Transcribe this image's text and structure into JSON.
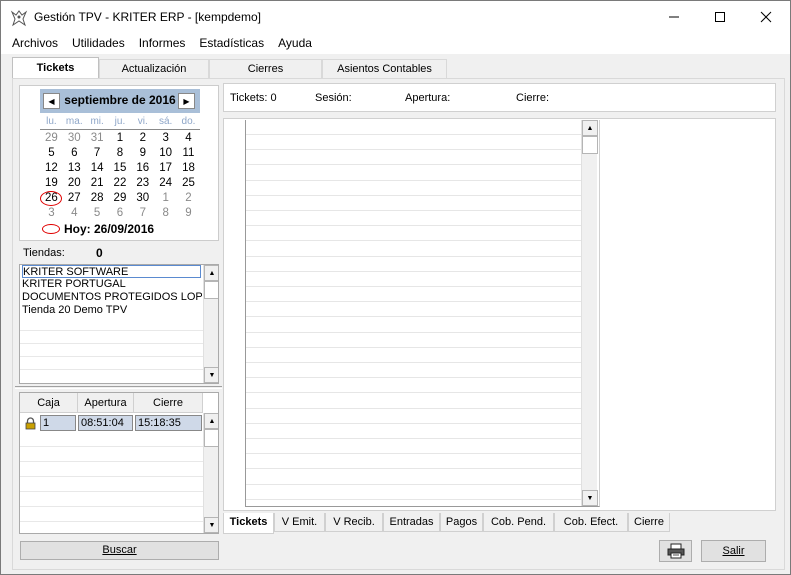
{
  "window": {
    "title": "Gestión TPV - KRITER ERP - [kempdemo]",
    "minimize": "—",
    "maximize": "☐",
    "close": "✕"
  },
  "menu": [
    "Archivos",
    "Utilidades",
    "Informes",
    "Estadísticas",
    "Ayuda"
  ],
  "main_tabs": [
    "Tickets",
    "Actualización",
    "Cierres",
    "Asientos Contables"
  ],
  "calendar": {
    "month": "septiembre de 2016",
    "weekdays": [
      "lu.",
      "ma.",
      "mi.",
      "ju.",
      "vi.",
      "sá.",
      "do."
    ],
    "weeks": [
      [
        {
          "d": "29",
          "m": true
        },
        {
          "d": "30",
          "m": true
        },
        {
          "d": "31",
          "m": true
        },
        {
          "d": "1"
        },
        {
          "d": "2"
        },
        {
          "d": "3"
        },
        {
          "d": "4"
        }
      ],
      [
        {
          "d": "5"
        },
        {
          "d": "6"
        },
        {
          "d": "7"
        },
        {
          "d": "8"
        },
        {
          "d": "9"
        },
        {
          "d": "10"
        },
        {
          "d": "11"
        }
      ],
      [
        {
          "d": "12"
        },
        {
          "d": "13"
        },
        {
          "d": "14"
        },
        {
          "d": "15"
        },
        {
          "d": "16"
        },
        {
          "d": "17"
        },
        {
          "d": "18"
        }
      ],
      [
        {
          "d": "19"
        },
        {
          "d": "20"
        },
        {
          "d": "21"
        },
        {
          "d": "22"
        },
        {
          "d": "23",
          "sel": true
        },
        {
          "d": "24"
        },
        {
          "d": "25"
        }
      ],
      [
        {
          "d": "26",
          "today": true
        },
        {
          "d": "27"
        },
        {
          "d": "28"
        },
        {
          "d": "29"
        },
        {
          "d": "30"
        },
        {
          "d": "1",
          "m": true
        },
        {
          "d": "2",
          "m": true
        }
      ],
      [
        {
          "d": "3",
          "m": true
        },
        {
          "d": "4",
          "m": true
        },
        {
          "d": "5",
          "m": true
        },
        {
          "d": "6",
          "m": true
        },
        {
          "d": "7",
          "m": true
        },
        {
          "d": "8",
          "m": true
        },
        {
          "d": "9",
          "m": true
        }
      ]
    ],
    "today_label": "Hoy: 26/09/2016",
    "prev": "◀",
    "next": "▶"
  },
  "tiendas": {
    "label": "Tiendas:",
    "count": "0",
    "items": [
      "KRITER SOFTWARE",
      "KRITER PORTUGAL",
      "DOCUMENTOS PROTEGIDOS LOPD",
      "Tienda 20 Demo TPV"
    ]
  },
  "caja_grid": {
    "headers": [
      "Caja",
      "Apertura",
      "Cierre"
    ],
    "rows": [
      {
        "caja": "1",
        "apertura": "08:51:04",
        "cierre": "15:18:35"
      }
    ]
  },
  "buscar_label": "Buscar",
  "info_bar": {
    "tickets": "Tickets: 0",
    "sesion": "Sesión:",
    "apertura": "Apertura:",
    "cierre": "Cierre:"
  },
  "bottom_tabs": [
    "Tickets",
    "V Emit.",
    "V Recib.",
    "Entradas",
    "Pagos",
    "Cob. Pend.",
    "Cob. Efect.",
    "Cierre"
  ],
  "salir_label": "Salir",
  "icons": {
    "printer": "printer-icon",
    "lock": "lock-icon",
    "app": "app-logo-icon"
  },
  "colors": {
    "calendar_header": "#a9bfd8",
    "today_mark": "#e00000",
    "row_select": "#cfd9e8"
  }
}
